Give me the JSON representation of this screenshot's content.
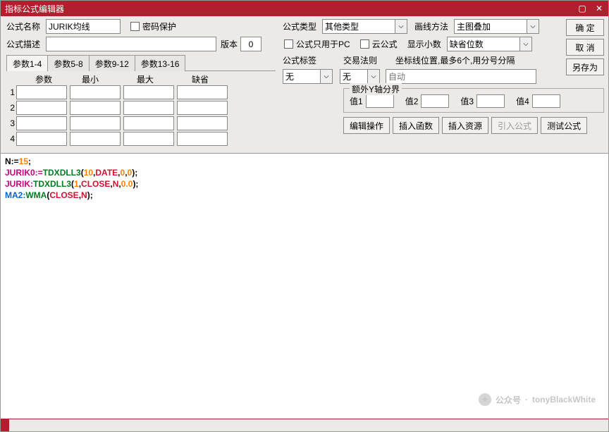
{
  "window": {
    "title": "指标公式编辑器"
  },
  "labels": {
    "name": "公式名称",
    "pwd": "密码保护",
    "desc": "公式描述",
    "ver": "版本",
    "type": "公式类型",
    "draw": "画线方法",
    "pcOnly": "公式只用于PC",
    "cloud": "云公式",
    "decimal": "显示小数",
    "tag": "公式标签",
    "rule": "交易法则",
    "cursorHint": "坐标线位置,最多6个,用分号分隔",
    "autoPH": "自动",
    "extraY": "额外Y轴分界",
    "v1": "值1",
    "v2": "值2",
    "v3": "值3",
    "v4": "值4"
  },
  "fields": {
    "name": "JURIK均线",
    "desc": "",
    "ver": "0",
    "typeSel": "其他类型",
    "drawSel": "主图叠加",
    "decimalSel": "缺省位数",
    "tagSel": "无",
    "ruleSel": "无"
  },
  "tabs": {
    "t1": "参数1-4",
    "t2": "参数5-8",
    "t3": "参数9-12",
    "t4": "参数13-16"
  },
  "paramHeaders": {
    "p": "参数",
    "min": "最小",
    "max": "最大",
    "def": "缺省"
  },
  "paramRows": [
    "1",
    "2",
    "3",
    "4"
  ],
  "buttons": {
    "ok": "确 定",
    "cancel": "取 消",
    "saveAs": "另存为",
    "editOp": "编辑操作",
    "insFn": "插入函数",
    "insRes": "插入资源",
    "import": "引入公式",
    "test": "测试公式"
  },
  "code": {
    "l1a": "N:=",
    "l1b": "15",
    "l1c": ";",
    "l2a": "JURIK0:=",
    "l2b": "TDXDLL3",
    "l2c": "(",
    "l2d": "10",
    "l2e": ",",
    "l2f": "DATE",
    "l2g": ",",
    "l2h": "0",
    "l2i": ",",
    "l2j": "0",
    "l2k": ");",
    "l3a": "JURIK:",
    "l3b": "TDXDLL3",
    "l3c": "(",
    "l3d": "1",
    "l3e": ",",
    "l3f": "CLOSE",
    "l3g": ",",
    "l3h": "N",
    "l3i": ",",
    "l3j": "0.0",
    "l3k": ");",
    "l4a": "MA2:",
    "l4b": "WMA",
    "l4c": "(",
    "l4d": "CLOSE",
    "l4e": ",",
    "l4f": "N",
    "l4g": ");"
  },
  "watermark": {
    "label": "公众号",
    "name": "tonyBlackWhite"
  }
}
